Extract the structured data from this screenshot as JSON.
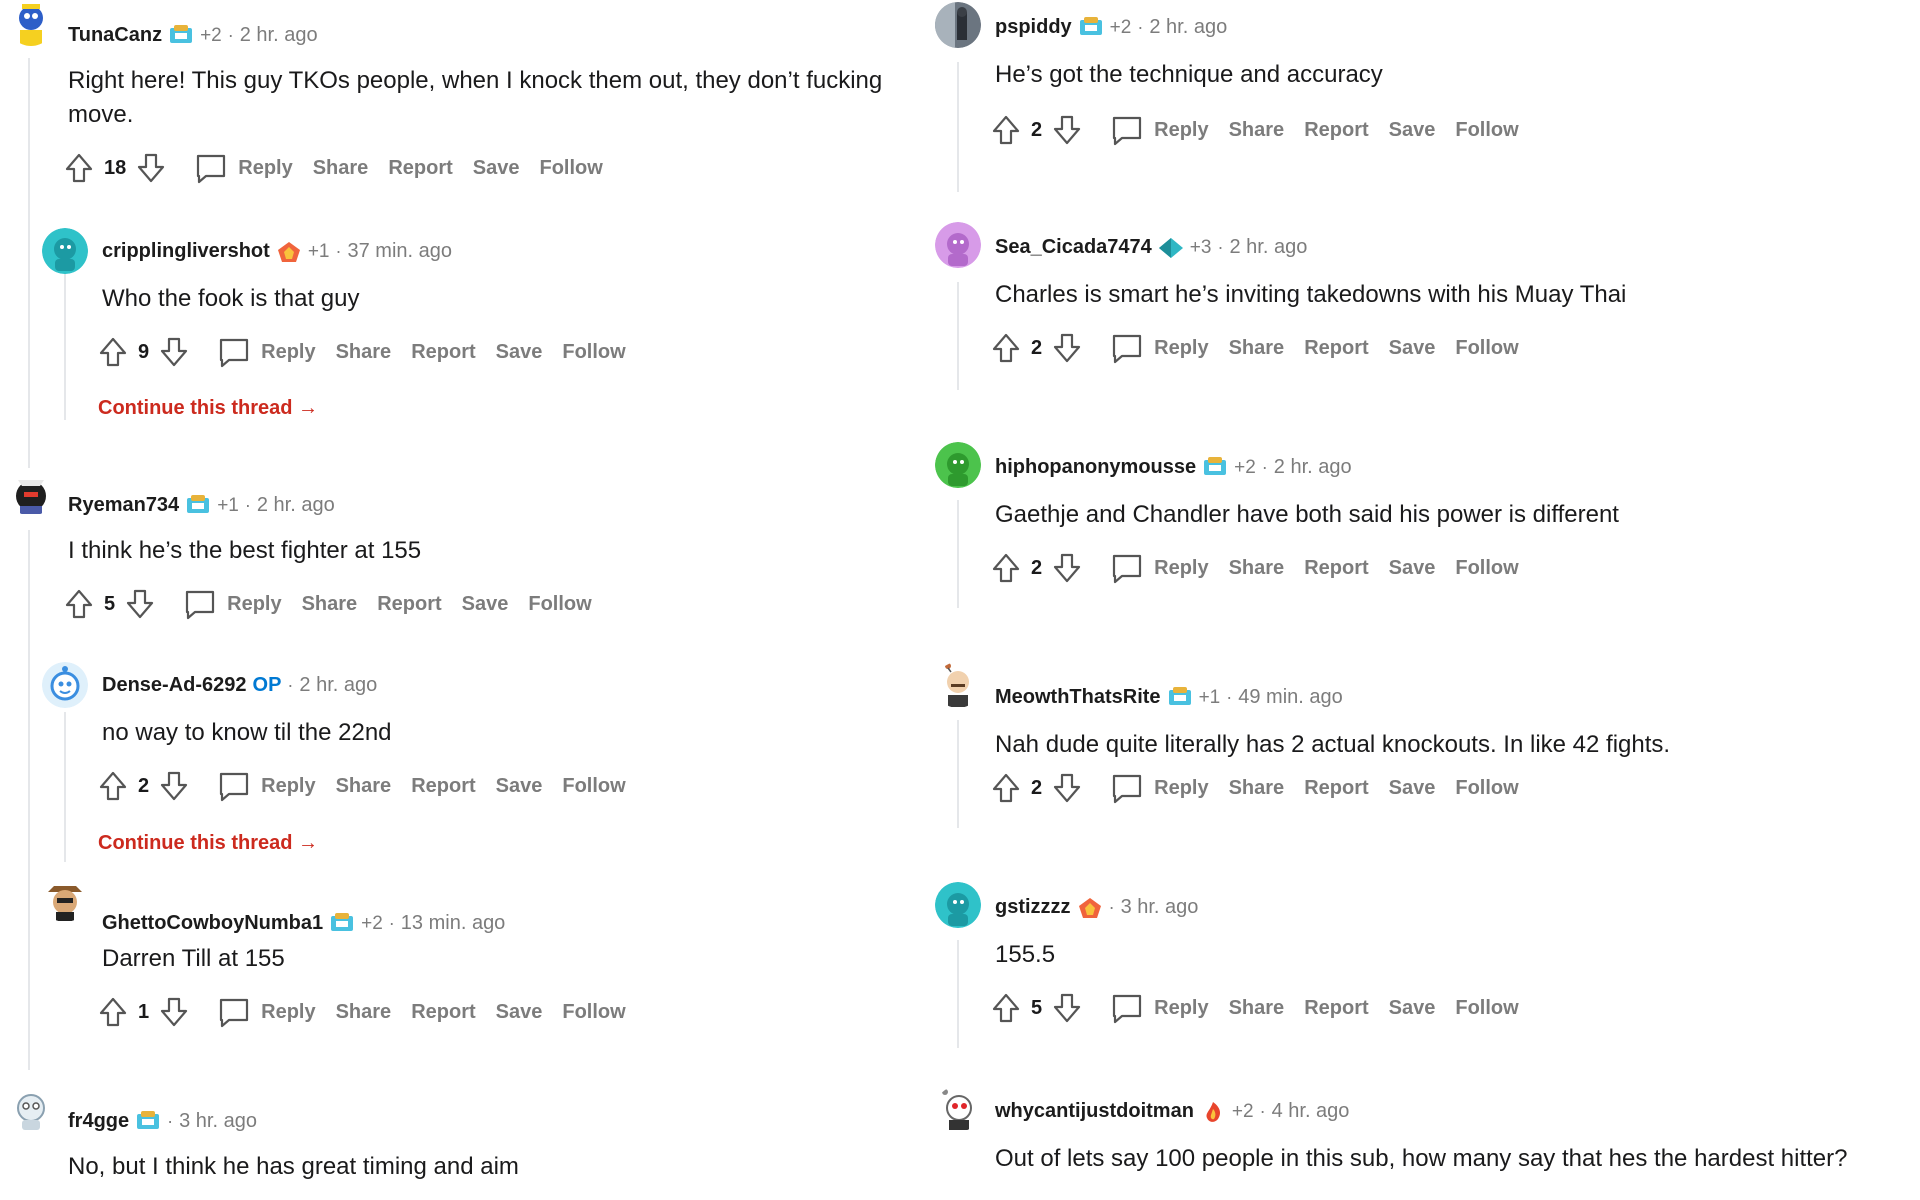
{
  "actions": {
    "reply": "Reply",
    "share": "Share",
    "report": "Report",
    "save": "Save",
    "follow": "Follow"
  },
  "continue_label": "Continue this thread →",
  "op_badge": "OP",
  "left": [
    {
      "username": "TunaCanz",
      "flair": "trophy-flair-icon",
      "plus": "+2",
      "time": "2 hr. ago",
      "text": "Right here! This guy TKOs people, when I knock them out, they don’t fucking move.",
      "score": "18"
    },
    {
      "username": "cripplinglivershot",
      "flair": "fire-flair-icon",
      "plus": "+1",
      "time": "37 min. ago",
      "text": "Who the fook is that guy",
      "score": "9"
    },
    {
      "username": "Ryeman734",
      "flair": "trophy-flair-icon",
      "plus": "+1",
      "time": "2 hr. ago",
      "text": "I think he’s the best fighter at 155",
      "score": "5"
    },
    {
      "username": "Dense-Ad-6292",
      "flair": "",
      "plus": "",
      "time": "2 hr. ago",
      "text": "no way to know til the 22nd",
      "score": "2"
    },
    {
      "username": "GhettoCowboyNumba1",
      "flair": "trophy-flair-icon",
      "plus": "+2",
      "time": "13 min. ago",
      "text": "Darren Till at 155",
      "score": "1"
    },
    {
      "username": "fr4gge",
      "flair": "trophy-flair-icon",
      "plus": "",
      "time": "3 hr. ago",
      "text": "No, but I think he has great timing and aim",
      "score": ""
    }
  ],
  "right": [
    {
      "username": "pspiddy",
      "flair": "trophy-flair-icon",
      "plus": "+2",
      "time": "2 hr. ago",
      "text": "He’s got the technique and accuracy",
      "score": "2"
    },
    {
      "username": "Sea_Cicada7474",
      "flair": "gem-flair-icon",
      "plus": "+3",
      "time": "2 hr. ago",
      "text": "Charles is smart he’s inviting takedowns with his Muay Thai",
      "score": "2"
    },
    {
      "username": "hiphopanonymousse",
      "flair": "trophy-flair-icon",
      "plus": "+2",
      "time": "2 hr. ago",
      "text": "Gaethje and Chandler have both said his power is different",
      "score": "2"
    },
    {
      "username": "MeowthThatsRite",
      "flair": "trophy-flair-icon",
      "plus": "+1",
      "time": "49 min. ago",
      "text": "Nah dude quite literally has 2 actual knockouts. In like 42 fights.",
      "score": "2"
    },
    {
      "username": "gstizzzz",
      "flair": "fire-flair-icon",
      "plus": "",
      "time": "3 hr. ago",
      "text": "155.5",
      "score": "5"
    },
    {
      "username": "whycantijustdoitman",
      "flair": "flame-flair-icon",
      "plus": "+2",
      "time": "4 hr. ago",
      "text": "Out of lets say 100 people in this sub, how many say that hes the hardest hitter?",
      "score": ""
    }
  ],
  "colors": {
    "accent_red": "#cc2a1e",
    "op_blue": "#0079d3",
    "muted": "#7c7c7c"
  }
}
